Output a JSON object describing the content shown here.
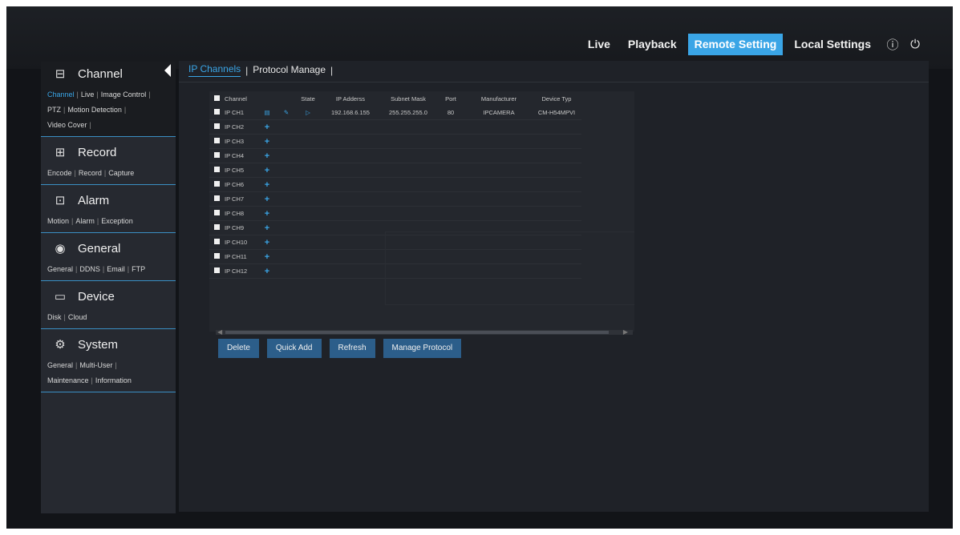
{
  "topnav": {
    "items": [
      {
        "label": "Live",
        "active": false
      },
      {
        "label": "Playback",
        "active": false
      },
      {
        "label": "Remote Setting",
        "active": true
      },
      {
        "label": "Local Settings",
        "active": false
      }
    ],
    "icons": [
      "info-icon",
      "power-icon"
    ],
    "accent": "#3aa5e6"
  },
  "sidebar": {
    "sections": [
      {
        "title": "Channel",
        "icon": "channel-icon",
        "links": [
          [
            "Channel",
            "Live",
            "Image Control"
          ],
          [
            "PTZ",
            "Motion Detection"
          ],
          [
            "Video Cover"
          ]
        ]
      },
      {
        "title": "Record",
        "icon": "record-icon",
        "links": [
          [
            "Encode",
            "Record",
            "Capture"
          ]
        ]
      },
      {
        "title": "Alarm",
        "icon": "alarm-icon",
        "links": [
          [
            "Motion",
            "Alarm",
            "Exception"
          ]
        ]
      },
      {
        "title": "General",
        "icon": "general-icon",
        "links": [
          [
            "General",
            "DDNS",
            "Email",
            "FTP"
          ]
        ]
      },
      {
        "title": "Device",
        "icon": "device-icon",
        "links": [
          [
            "Disk",
            "Cloud"
          ]
        ]
      },
      {
        "title": "System",
        "icon": "system-icon",
        "links": [
          [
            "General",
            "Multi-User"
          ],
          [
            "Maintenance",
            "Information"
          ]
        ]
      }
    ]
  },
  "tabs": [
    "IP Channels",
    "Protocol Manage"
  ],
  "table": {
    "headers": [
      "Channel",
      "State",
      "IP Adderss",
      "Subnet Mask",
      "Port",
      "Manufacturer",
      "Device Typ"
    ],
    "first_row": {
      "channel": "IP CH1",
      "ip": "192.168.6.155",
      "mask": "255.255.255.0",
      "port": "80",
      "manufacturer": "IPCAMERA",
      "device_type": "CM-H54MPVI"
    },
    "empty_rows": [
      "IP CH2",
      "IP CH3",
      "IP CH4",
      "IP CH5",
      "IP CH6",
      "IP CH7",
      "IP CH8",
      "IP CH9",
      "IP CH10",
      "IP CH11",
      "IP CH12"
    ],
    "add_symbol": "+"
  },
  "buttons": [
    "Delete",
    "Quick Add",
    "Refresh",
    "Manage Protocol"
  ]
}
